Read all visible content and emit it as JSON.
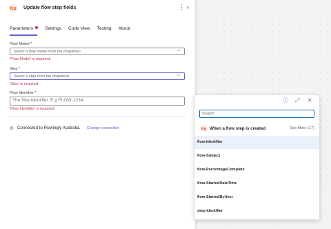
{
  "header": {
    "title": "Update flow step fields"
  },
  "tabs": [
    {
      "label": "Parameters"
    },
    {
      "label": "Settings"
    },
    {
      "label": "Code View"
    },
    {
      "label": "Testing"
    },
    {
      "label": "About"
    }
  ],
  "fields": {
    "flow_model": {
      "label": "Flow Model *",
      "placeholder": "Select a flow model from the dropdown",
      "error": "'Flow Model' is required."
    },
    "step": {
      "label": "Step *",
      "placeholder": "Select a step from the dropdown",
      "error": "'Step' is required."
    },
    "flow_identifier": {
      "label": "Flow Identifier *",
      "placeholder": "The flow identifier. E.g FLOW-1234",
      "error": "'Flow Identifier' is required."
    }
  },
  "connection": {
    "text": "Connected to Flowingly Australia.",
    "link": "Change connection"
  },
  "popup": {
    "search_placeholder": "Search",
    "trigger_title": "When a flow step is created",
    "see_more": "See More (17)",
    "items": [
      {
        "label": "flow-Identifier"
      },
      {
        "label": "flow-Subject"
      },
      {
        "label": "flow-PercentageComplete"
      },
      {
        "label": "flow-StartedDateTime"
      },
      {
        "label": "flow-StartedByUser"
      },
      {
        "label": "step-Identifier"
      }
    ]
  },
  "icons": {
    "logo": "flowingly-logo-icon",
    "more": "more-vertical-icon",
    "collapse": "chevron-left-icon",
    "dropdown": "chevron-down-icon",
    "connection": "link-icon",
    "info": "info-icon",
    "expand": "expand-icon",
    "close": "close-icon"
  },
  "colors": {
    "accent": "#5b5fc7",
    "error": "#c4314b",
    "brand": "#e8642a",
    "highlight": "#ebf1fb"
  }
}
